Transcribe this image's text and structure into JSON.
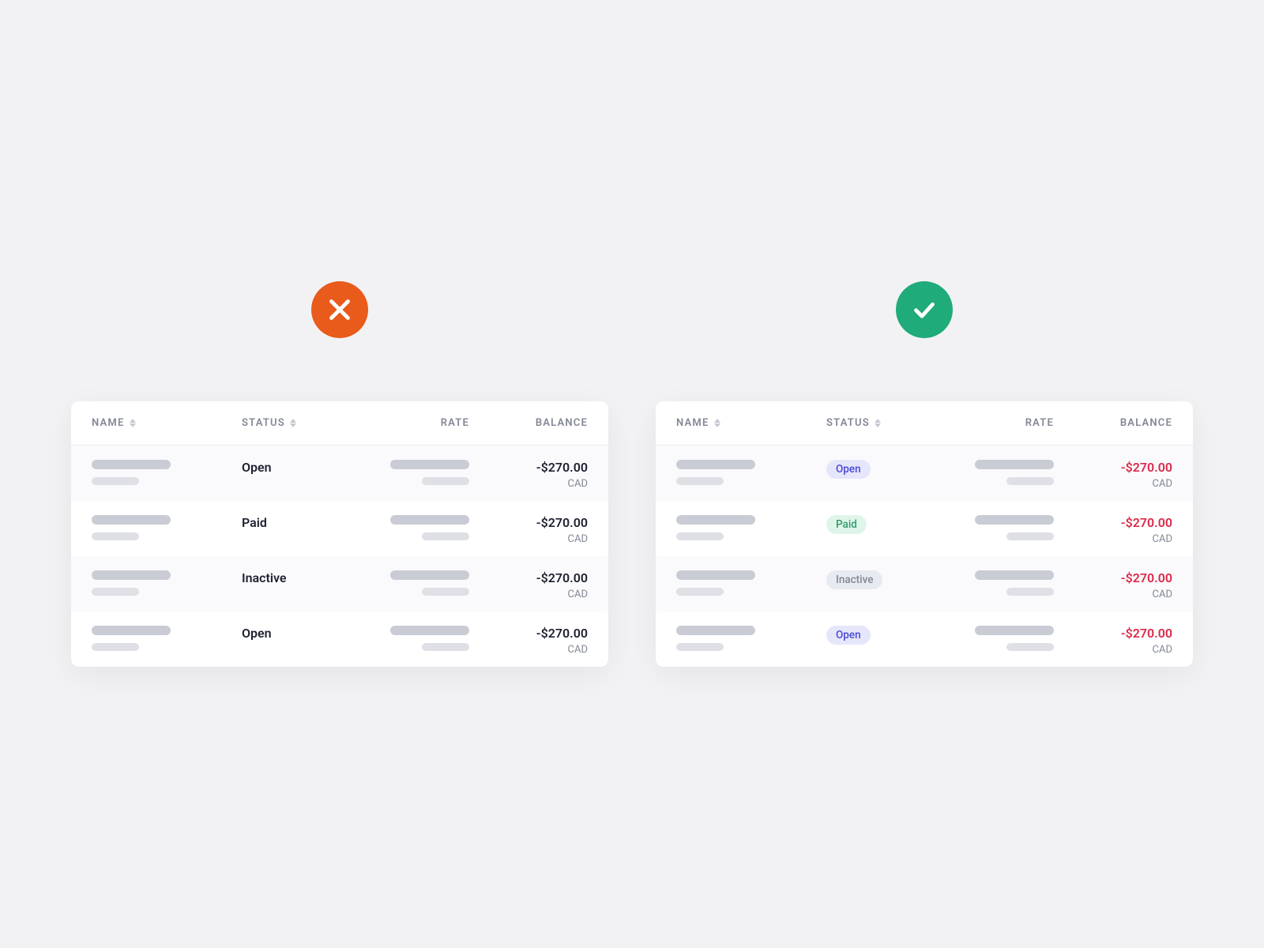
{
  "columns": {
    "name": "NAME",
    "status": "STATUS",
    "rate": "RATE",
    "balance": "BALANCE"
  },
  "rows": [
    {
      "status": "Open",
      "status_kind": "open",
      "balance": "-$270.00",
      "currency": "CAD"
    },
    {
      "status": "Paid",
      "status_kind": "paid",
      "balance": "-$270.00",
      "currency": "CAD"
    },
    {
      "status": "Inactive",
      "status_kind": "inactive",
      "balance": "-$270.00",
      "currency": "CAD"
    },
    {
      "status": "Open",
      "status_kind": "open",
      "balance": "-$270.00",
      "currency": "CAD"
    }
  ],
  "icons": {
    "bad": "incorrect",
    "good": "correct"
  }
}
